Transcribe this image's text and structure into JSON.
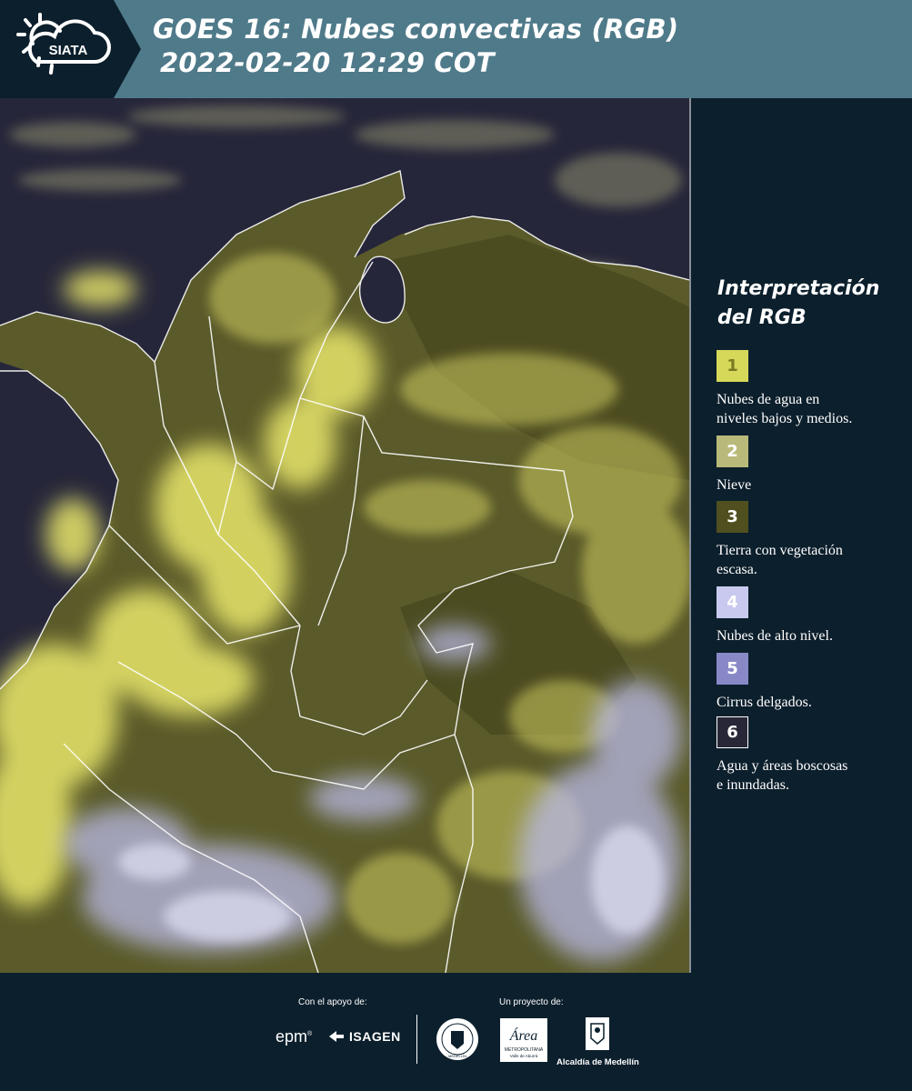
{
  "header": {
    "logo_text": "SIATA",
    "title_line1": "GOES 16: Nubes convectivas (RGB)",
    "title_line2": "2022-02-20 12:29 COT"
  },
  "legend": {
    "title_line1": "Interpretación",
    "title_line2": "del RGB",
    "items": [
      {
        "number": "1",
        "label_line1": "Nubes de agua en",
        "label_line2": "niveles bajos y medios.",
        "color": "#d6d85a",
        "num_color": "#7a7a20"
      },
      {
        "number": "2",
        "label_line1": "Nieve",
        "label_line2": "",
        "color": "#b9b97a",
        "num_color": "#ffffff"
      },
      {
        "number": "3",
        "label_line1": "Tierra con vegetación",
        "label_line2": "escasa.",
        "color": "#4f4f1f",
        "num_color": "#ffffff"
      },
      {
        "number": "4",
        "label_line1": "Nubes de alto nivel.",
        "label_line2": "",
        "color": "#c9c9f0",
        "num_color": "#ffffff"
      },
      {
        "number": "5",
        "label_line1": "Cirrus delgados.",
        "label_line2": "",
        "color": "#8888c7",
        "num_color": "#ffffff"
      },
      {
        "number": "6",
        "label_line1": "Agua y áreas boscosas",
        "label_line2": "e inundadas.",
        "color": "#272738",
        "num_color": "#ffffff"
      }
    ]
  },
  "footer": {
    "support_label": "Con el apoyo de:",
    "project_label": "Un proyecto de:",
    "epm": "epm",
    "isagen": "ISAGEN",
    "seal_text": "MEDELLÍN",
    "area_script": "Área",
    "area_line1": "METROPOLITANA",
    "area_line2": "Valle de Aburrá",
    "alcaldia": "Alcaldía de Medellín"
  },
  "colors": {
    "header_bg": "#4f7a8a",
    "panel_bg": "#0c1f2c",
    "ocean": "#2a2a3e",
    "land": "#5f5f2c",
    "low_clouds": "#e6e46a",
    "high_clouds": "#c8c8ec"
  }
}
